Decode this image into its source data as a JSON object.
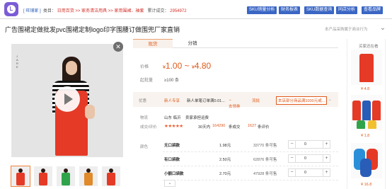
{
  "topbar": {
    "tag": "[ 旺铺家 ]",
    "breadcrumb_prefix": "类目：",
    "crumb1": "日用百货",
    "crumb2": "家务清洁用具",
    "crumb3": "家用围裙、袖套",
    "sales_label": "累计成交：",
    "sales_value": "2954972",
    "buttons": [
      "SKU销量分析",
      "财务报表",
      "SKU数据查询",
      "同店分析",
      "查看品牌"
    ]
  },
  "title": "广告围裙定做批发pvc围裙定制logo印字围腰订做围兜厂家直销",
  "hint": "本产品采购属于商业行为",
  "side_text": "J A R E",
  "tabs": [
    "现货",
    "分销"
  ],
  "price": {
    "label": "价格",
    "low": "1.00",
    "high": "4.80",
    "currency": "¥",
    "sep": "~",
    "min_order_label": "起批量",
    "min_order_value": "≥100 条"
  },
  "pref": {
    "label": "优惠",
    "badge": "新人专享",
    "text": "新人单笔订单满0.01...",
    "link": "去领券",
    "flow_label": "流批",
    "flow_text": "本店部分商品满1000元或..."
  },
  "shipping": {
    "label": "物流",
    "origin": "山东 临沂",
    "text": "卖家承担运费"
  },
  "rating": {
    "label": "成交/评价",
    "stars": "★★★★★",
    "days": "30天内",
    "count": "164290",
    "count_suffix": "条成交",
    "reviews": "1627",
    "reviews_suffix": "条评价"
  },
  "specs": {
    "label": "颜色",
    "rows": [
      {
        "name": "无口袋款",
        "price": "1.98元",
        "stock": "33770 条可售",
        "qty": "0"
      },
      {
        "name": "有口袋款",
        "price": "2.50元",
        "stock": "62876 条可售",
        "qty": "0"
      },
      {
        "name": "小额口袋款",
        "price": "2.70元",
        "stock": "47928 条可售",
        "qty": "0"
      }
    ]
  },
  "sidebar": {
    "title": "买家还在看",
    "items": [
      {
        "price": "¥ 4.8"
      },
      {
        "price": "¥ 1.8"
      },
      {
        "price": "¥ 16.8"
      }
    ]
  },
  "colors": {
    "accent": "#e05a1c",
    "brand": "#3a66c4",
    "apron_red": "#e53a26"
  }
}
